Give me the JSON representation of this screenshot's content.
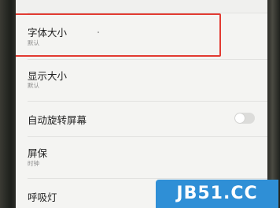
{
  "settings": {
    "items": [
      {
        "title": "字体大小",
        "subtitle": "默认"
      },
      {
        "title": "显示大小",
        "subtitle": "默认"
      },
      {
        "title": "自动旋转屏幕",
        "toggle": false
      },
      {
        "title": "屏保",
        "subtitle": "时钟"
      },
      {
        "title": "呼吸灯"
      }
    ]
  },
  "highlight_color": "#e23b32",
  "watermark": {
    "text": "JB51.CC",
    "color": "#2f8fd6"
  }
}
